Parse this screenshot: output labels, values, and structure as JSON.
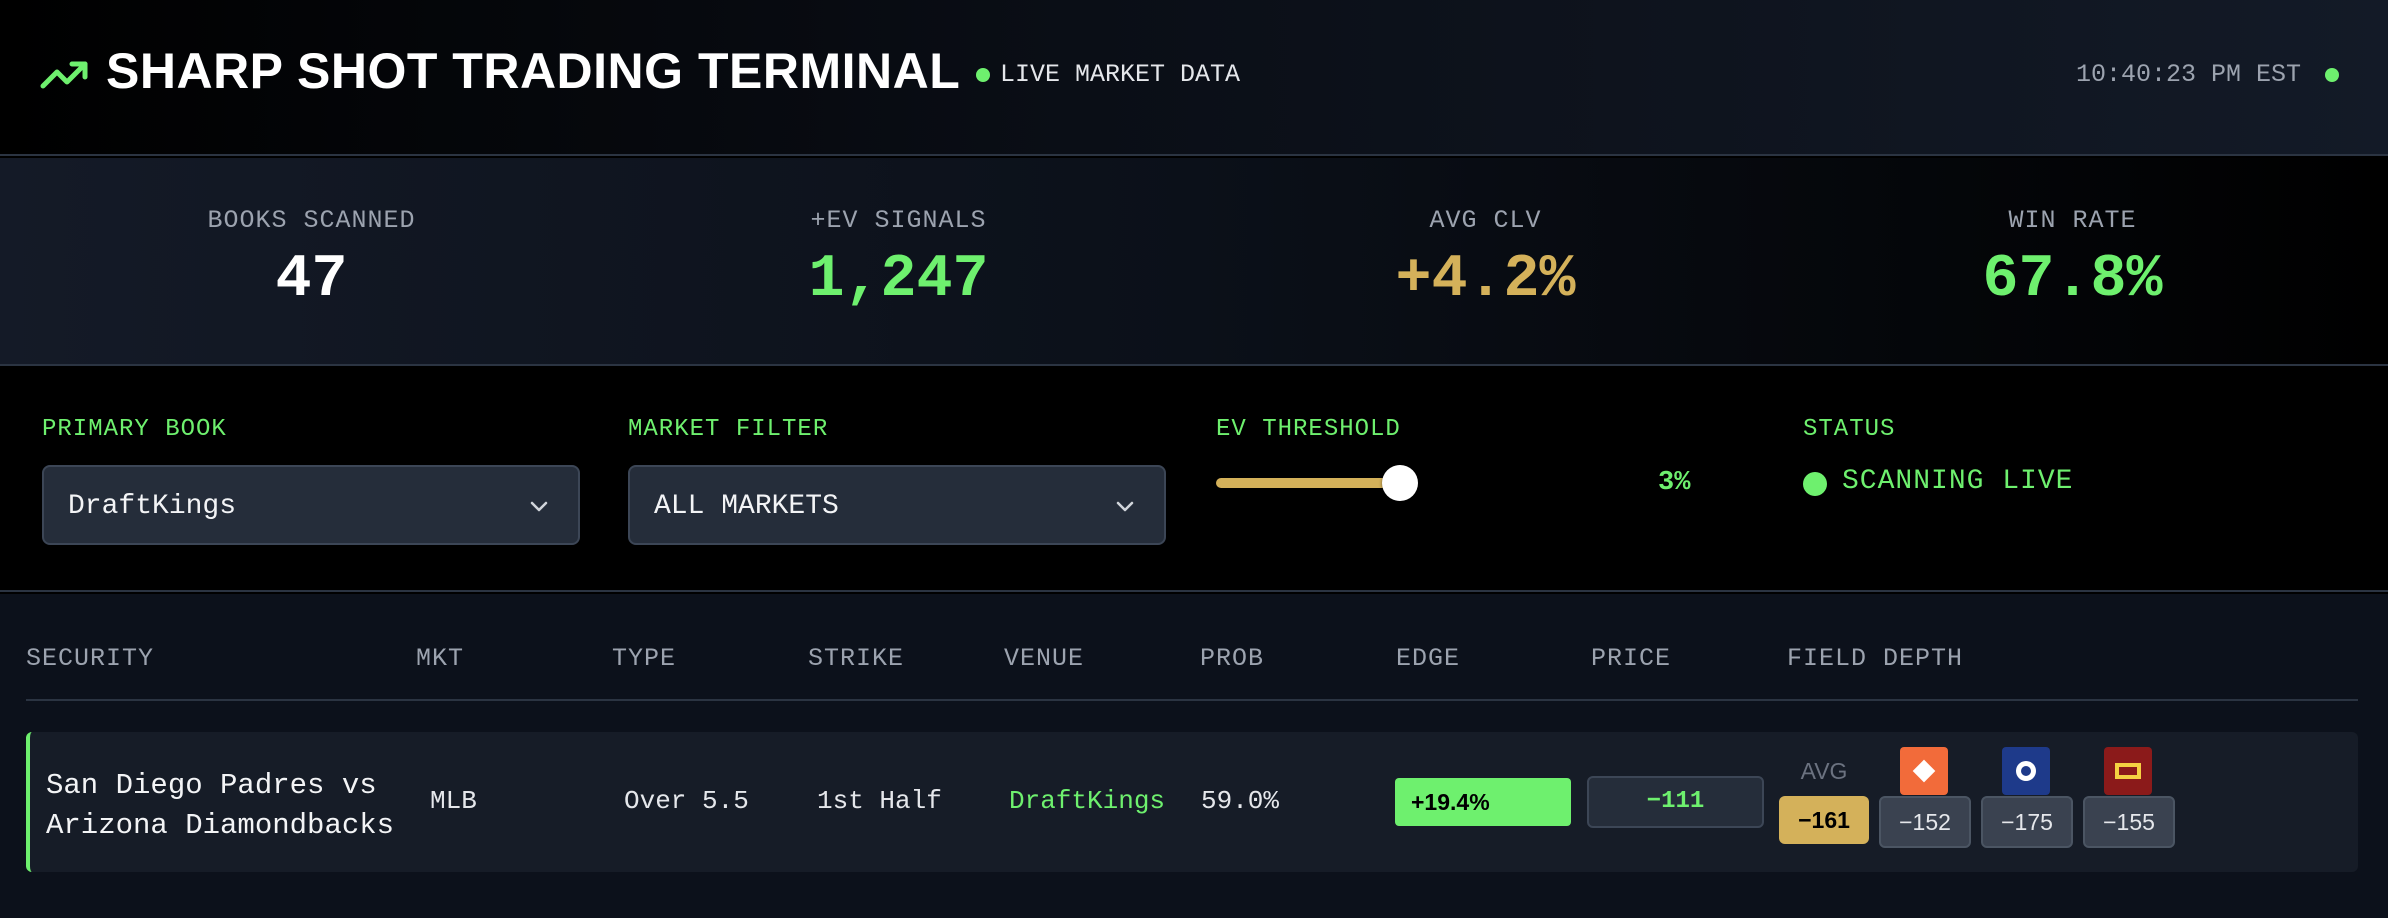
{
  "header": {
    "title": "SHARP SHOT TRADING TERMINAL",
    "live_label": "LIVE MARKET DATA",
    "clock": "10:40:23 PM EST",
    "colors": {
      "accent": "#6ef06e",
      "gold": "#d4b15a"
    }
  },
  "stats": [
    {
      "label": "BOOKS SCANNED",
      "value": "47",
      "color": "#ffffff"
    },
    {
      "label": "+EV SIGNALS",
      "value": "1,247",
      "color": "#6ef06e"
    },
    {
      "label": "AVG CLV",
      "value": "+4.2%",
      "color": "#d4b15a"
    },
    {
      "label": "WIN RATE",
      "value": "67.8%",
      "color": "#6ef06e"
    }
  ],
  "controls": {
    "primary_book": {
      "label": "PRIMARY BOOK",
      "value": "DraftKings"
    },
    "market_filter": {
      "label": "MARKET FILTER",
      "value": "ALL MARKETS"
    },
    "ev_threshold": {
      "label": "EV THRESHOLD",
      "value": "3%",
      "slider_fraction": 1.0
    },
    "status": {
      "label": "STATUS",
      "value": "SCANNING LIVE"
    }
  },
  "table": {
    "headers": [
      "SECURITY",
      "MKT",
      "TYPE",
      "STRIKE",
      "VENUE",
      "PROB",
      "EDGE",
      "PRICE",
      "FIELD DEPTH"
    ],
    "rows": [
      {
        "security": "San Diego Padres vs Arizona Diamondbacks",
        "mkt": "MLB",
        "type": "Over 5.5",
        "strike": "1st Half",
        "venue": "DraftKings",
        "prob": "59.0%",
        "edge": "+19.4%",
        "price": "−111",
        "field_depth": {
          "avg_label": "AVG",
          "avg": "−161",
          "books": [
            {
              "icon": "orange-diamond-book-icon",
              "color": "#f26b3a",
              "price": "−152"
            },
            {
              "icon": "blue-ring-book-icon",
              "color": "#1e3a8a",
              "price": "−175"
            },
            {
              "icon": "red-rect-book-icon",
              "color": "#8b1a1a",
              "price": "−155"
            }
          ]
        }
      }
    ]
  }
}
